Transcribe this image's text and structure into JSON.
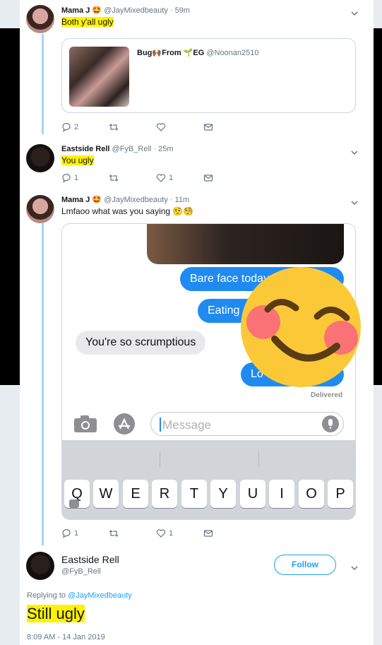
{
  "tweets": [
    {
      "name": "Mama J",
      "name_emoji": "🤩",
      "handle": "@JayMixedbeauty",
      "time": "· 59m",
      "text": "Both y'all ugly",
      "quote": {
        "name_prefix": "Bug",
        "name_mid": "From",
        "name_suffix": "EG",
        "handle": "@Noonan2510"
      },
      "actions": {
        "reply_count": "2",
        "retweet_count": "",
        "like_count": ""
      }
    },
    {
      "name": "Eastside Rell",
      "handle": "@FyB_Rell",
      "time": "· 25m",
      "text": "You ugly",
      "actions": {
        "reply_count": "1",
        "retweet_count": "",
        "like_count": "1"
      }
    },
    {
      "name": "Mama J",
      "name_emoji": "🤩",
      "handle": "@JayMixedbeauty",
      "time": "· 11m",
      "text": "Lmfaoo what was you saying 🤨🧐",
      "actions": {
        "reply_count": "1",
        "retweet_count": "",
        "like_count": "1"
      }
    }
  ],
  "screenshot": {
    "bubbles": [
      {
        "text": "Bare face today",
        "side": "right"
      },
      {
        "text": "Eating a",
        "side": "right"
      },
      {
        "text": "You're so scrumptious",
        "side": "left"
      },
      {
        "text": "Lo",
        "side": "right"
      }
    ],
    "delivered": "Delivered",
    "message_placeholder": "Message",
    "keys": [
      "Q",
      "W",
      "E",
      "R",
      "T",
      "Y",
      "U",
      "I",
      "O",
      "P"
    ]
  },
  "main_tweet": {
    "name": "Eastside Rell",
    "handle": "@FyB_Rell",
    "follow_label": "Follow",
    "replying_prefix": "Replying to",
    "replying_handle": "@JayMixedbeauty",
    "text": "Still ugly",
    "timestamp": "8:09 AM - 14 Jan 2019"
  },
  "colors": {
    "accent": "#1da1f2",
    "highlight": "#fff200",
    "imessage_blue": "#1f8bf0"
  }
}
